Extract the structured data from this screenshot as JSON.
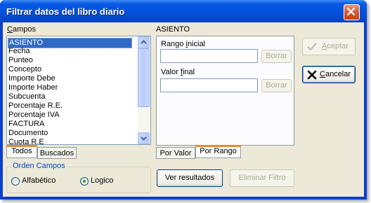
{
  "window": {
    "title": "Filtrar datos del libro diario"
  },
  "campos": {
    "label_prefix": "",
    "label_hot": "C",
    "label_rest": "ampos",
    "items": [
      "ASIENTO",
      "Fecha",
      "Punteo",
      "Concepto",
      "Importe Debe",
      "Importe Haber",
      "Subcuenta",
      "Porcentaje R.E.",
      "Porcentaje IVA",
      "FACTURA",
      "Documento",
      "Cuota R.E"
    ],
    "selected": "ASIENTO"
  },
  "left_tabs": {
    "todos": "Todos",
    "buscados": "Buscados"
  },
  "orden": {
    "title": "Orden Campos",
    "alfabetico": "Alfabético",
    "logico": "Logico",
    "selected": "Logico"
  },
  "asiento": {
    "header": "ASIENTO",
    "rango_inicial_a": "Rango ",
    "rango_inicial_hot": "i",
    "rango_inicial_b": "nicial",
    "rango_inicial_value": "",
    "valor_final_a": "Valor ",
    "valor_final_hot": "f",
    "valor_final_b": "inal",
    "valor_final_value": "",
    "borrar1": "Borrar",
    "borrar2": "Borrar"
  },
  "right_tabs": {
    "por_valor": "Por Valor",
    "por_rango": "Por Rango"
  },
  "buttons": {
    "aceptar_hot": "A",
    "aceptar_rest": "ceptar",
    "cancelar_hot": "C",
    "cancelar_rest": "ancelar",
    "ver_resultados": "Ver resultados",
    "eliminar_filtro": "Eliminar Filtro"
  }
}
